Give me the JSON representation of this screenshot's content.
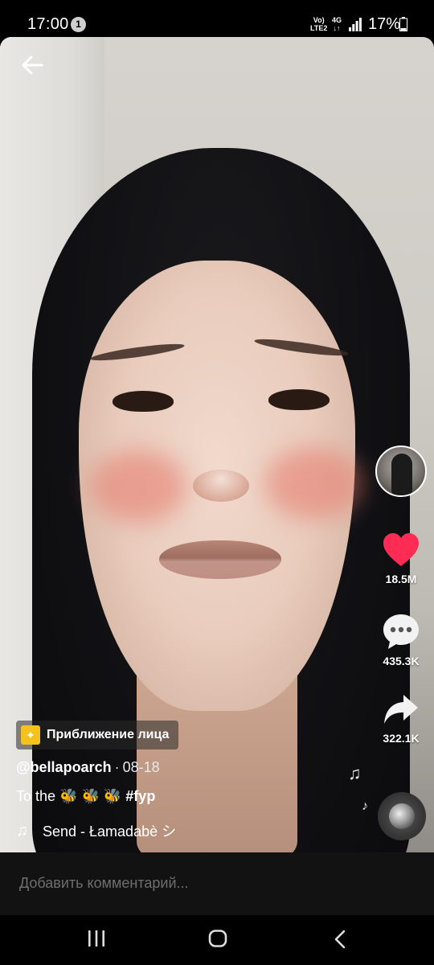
{
  "status_bar": {
    "time": "17:00",
    "notification_count": "1",
    "network_line1": "Vo)",
    "network_line2": "LTE2",
    "network_type": "4G",
    "battery": "17%"
  },
  "video": {
    "effect_label": "Приближение лица",
    "author": "@bellapoarch",
    "date": "08-18",
    "caption_text": "To the 🐝 🐝 🐝",
    "hashtag": "#fyp",
    "sound": "Send - Łamadabè シ"
  },
  "rail": {
    "likes": "18.5M",
    "comments": "435.3K",
    "shares": "322.1K"
  },
  "comment_bar": {
    "placeholder": "Добавить комментарий..."
  },
  "colors": {
    "like_red": "#fe2c55",
    "effect_yellow": "#f4c21d",
    "comment_bar_bg": "#121212"
  },
  "icons": [
    "back-arrow-icon",
    "heart-icon",
    "comment-icon",
    "share-icon",
    "music-note-icon",
    "recents-icon",
    "home-icon",
    "nav-back-icon"
  ]
}
